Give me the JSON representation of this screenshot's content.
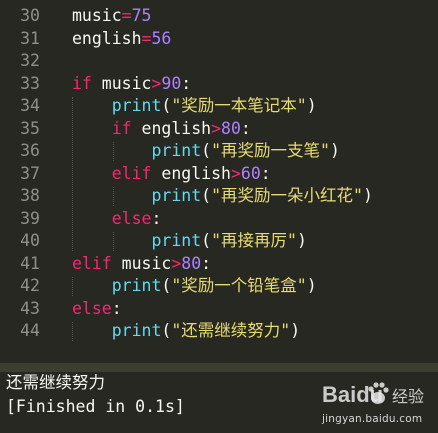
{
  "editor": {
    "lines": [
      {
        "num": "30",
        "tokens": [
          {
            "t": "music",
            "c": "pl"
          },
          {
            "t": "=",
            "c": "op"
          },
          {
            "t": "75",
            "c": "num"
          }
        ]
      },
      {
        "num": "31",
        "tokens": [
          {
            "t": "english",
            "c": "pl"
          },
          {
            "t": "=",
            "c": "op"
          },
          {
            "t": "56",
            "c": "num"
          }
        ]
      },
      {
        "num": "32",
        "tokens": []
      },
      {
        "num": "33",
        "tokens": [
          {
            "t": "if",
            "c": "kw"
          },
          {
            "t": " music",
            "c": "pl"
          },
          {
            "t": ">",
            "c": "op"
          },
          {
            "t": "90",
            "c": "num"
          },
          {
            "t": ":",
            "c": "pl"
          }
        ]
      },
      {
        "num": "34",
        "tokens": [
          {
            "t": "    ",
            "c": "pl"
          },
          {
            "t": "print",
            "c": "fn"
          },
          {
            "t": "(",
            "c": "pl"
          },
          {
            "t": "\"奖励一本笔记本\"",
            "c": "str"
          },
          {
            "t": ")",
            "c": "pl"
          }
        ]
      },
      {
        "num": "35",
        "tokens": [
          {
            "t": "    ",
            "c": "pl"
          },
          {
            "t": "if",
            "c": "kw"
          },
          {
            "t": " english",
            "c": "pl"
          },
          {
            "t": ">",
            "c": "op"
          },
          {
            "t": "80",
            "c": "num"
          },
          {
            "t": ":",
            "c": "pl"
          }
        ]
      },
      {
        "num": "36",
        "tokens": [
          {
            "t": "        ",
            "c": "pl"
          },
          {
            "t": "print",
            "c": "fn"
          },
          {
            "t": "(",
            "c": "pl"
          },
          {
            "t": "\"再奖励一支笔\"",
            "c": "str"
          },
          {
            "t": ")",
            "c": "pl"
          }
        ]
      },
      {
        "num": "37",
        "tokens": [
          {
            "t": "    ",
            "c": "pl"
          },
          {
            "t": "elif",
            "c": "kw"
          },
          {
            "t": " english",
            "c": "pl"
          },
          {
            "t": ">",
            "c": "op"
          },
          {
            "t": "60",
            "c": "num"
          },
          {
            "t": ":",
            "c": "pl"
          }
        ]
      },
      {
        "num": "38",
        "tokens": [
          {
            "t": "        ",
            "c": "pl"
          },
          {
            "t": "print",
            "c": "fn"
          },
          {
            "t": "(",
            "c": "pl"
          },
          {
            "t": "\"再奖励一朵小红花\"",
            "c": "str"
          },
          {
            "t": ")",
            "c": "pl"
          }
        ]
      },
      {
        "num": "39",
        "tokens": [
          {
            "t": "    ",
            "c": "pl"
          },
          {
            "t": "else",
            "c": "kw"
          },
          {
            "t": ":",
            "c": "pl"
          }
        ]
      },
      {
        "num": "40",
        "tokens": [
          {
            "t": "        ",
            "c": "pl"
          },
          {
            "t": "print",
            "c": "fn"
          },
          {
            "t": "(",
            "c": "pl"
          },
          {
            "t": "\"再接再厉\"",
            "c": "str"
          },
          {
            "t": ")",
            "c": "pl"
          }
        ]
      },
      {
        "num": "41",
        "tokens": [
          {
            "t": "elif",
            "c": "kw"
          },
          {
            "t": " music",
            "c": "pl"
          },
          {
            "t": ">",
            "c": "op"
          },
          {
            "t": "80",
            "c": "num"
          },
          {
            "t": ":",
            "c": "pl"
          }
        ]
      },
      {
        "num": "42",
        "tokens": [
          {
            "t": "    ",
            "c": "pl"
          },
          {
            "t": "print",
            "c": "fn"
          },
          {
            "t": "(",
            "c": "pl"
          },
          {
            "t": "\"奖励一个铅笔盒\"",
            "c": "str"
          },
          {
            "t": ")",
            "c": "pl"
          }
        ]
      },
      {
        "num": "43",
        "tokens": [
          {
            "t": "else",
            "c": "kw"
          },
          {
            "t": ":",
            "c": "pl"
          }
        ]
      },
      {
        "num": "44",
        "tokens": [
          {
            "t": "    ",
            "c": "pl"
          },
          {
            "t": "print",
            "c": "fn"
          },
          {
            "t": "(",
            "c": "pl"
          },
          {
            "t": "\"还需继续努力\"",
            "c": "str"
          },
          {
            "t": ")",
            "c": "pl"
          }
        ]
      }
    ]
  },
  "console": {
    "output_line": "还需继续努力",
    "finished_line": "[Finished in 0.1s]"
  },
  "watermark": {
    "brand": "Baidu",
    "label": "经验",
    "url": "jingyan.baidu.com"
  },
  "colors": {
    "background": "#272822",
    "keyword": "#f92672",
    "function": "#66d9ef",
    "number": "#ae81ff",
    "string": "#e6db74",
    "plain": "#f8f8f2",
    "line_number": "#8f908a"
  }
}
